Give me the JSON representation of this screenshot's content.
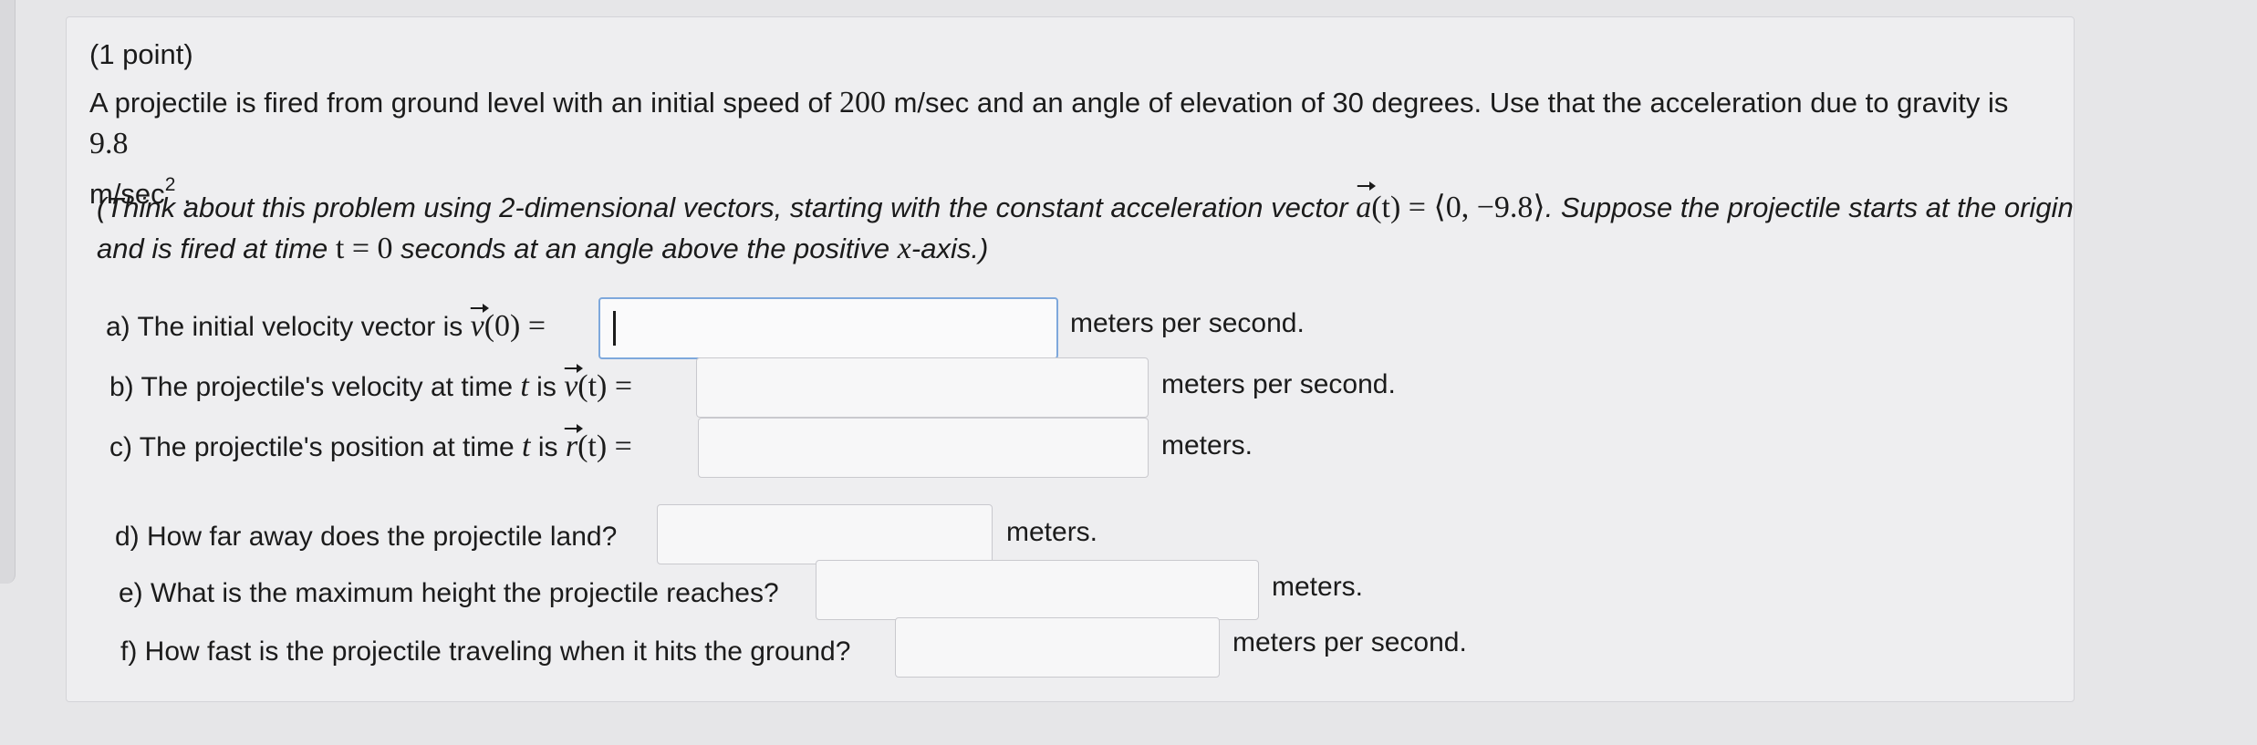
{
  "point_label": "(1 point)",
  "problem": {
    "text_1": "A projectile is fired from ground level with an initial speed of",
    "speed": "200",
    "text_2": "m/sec and an angle of elevation of 30 degrees. Use that the acceleration due to gravity is",
    "gravity": "9.8",
    "unit_base": "m/sec",
    "unit_exp": "2",
    "end": "."
  },
  "hint": {
    "text_1": "(Think about this problem using 2-dimensional vectors, starting with the constant acceleration vector",
    "accel_vec": "a",
    "accel_expr": "(t) = ⟨0, −9.8⟩",
    "text_2": ". Suppose the projectile starts at the origin",
    "text_3": "and is fired at time",
    "t_expr": "t = 0",
    "text_4": "seconds at an angle above the positive",
    "x_var": "x",
    "text_5": "-axis.)"
  },
  "questions": {
    "a": {
      "label": "a) The initial velocity vector is",
      "vec": "v",
      "expr": "(0) =",
      "unit": "meters per second.",
      "value": ""
    },
    "b": {
      "label": "b) The projectile's velocity at time",
      "var": "t",
      "is": "is",
      "vec": "v",
      "expr": "(t) =",
      "unit": "meters per second.",
      "value": ""
    },
    "c": {
      "label": "c) The projectile's position at time",
      "var": "t",
      "is": "is",
      "vec": "r",
      "expr": "(t) =",
      "unit": "meters.",
      "value": ""
    },
    "d": {
      "label": "d) How far away does the projectile land?",
      "unit": "meters.",
      "value": ""
    },
    "e": {
      "label": "e) What is the maximum height the projectile reaches?",
      "unit": "meters.",
      "value": ""
    },
    "f": {
      "label": "f) How fast is the projectile traveling when it hits the ground?",
      "unit": "meters per second.",
      "value": ""
    }
  }
}
